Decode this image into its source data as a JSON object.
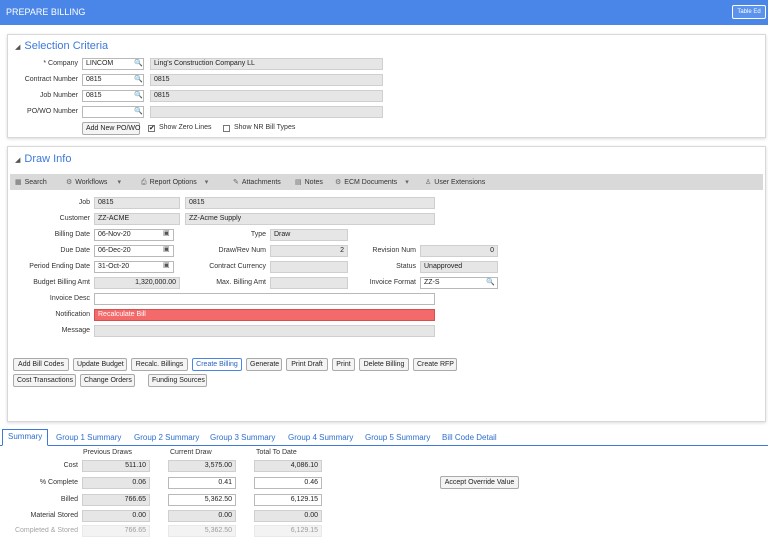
{
  "window": {
    "title": "PREPARE BILLING",
    "table_button": "Table Ed"
  },
  "selection": {
    "heading": "Selection Criteria",
    "company_label": "* Company",
    "company_value": "LINCOM",
    "company_name": "Ling's Construction Company LL",
    "contract_label": "Contract Number",
    "contract_value": "0815",
    "contract_desc": "0815",
    "job_label": "Job Number",
    "job_value": "0815",
    "job_desc": "0815",
    "powo_label": "PO/WO Number",
    "add_po_button": "Add New PO/WO",
    "show_zero_lines": "Show Zero Lines",
    "show_zero_checked": "✔",
    "show_nr_bill_types": "Show NR Bill Types"
  },
  "draw": {
    "heading": "Draw Info",
    "toolbar": {
      "search": "Search",
      "workflows": "Workflows",
      "report_options": "Report Options",
      "attachments": "Attachments",
      "notes": "Notes",
      "ecm": "ECM Documents",
      "user_ext": "User Extensions"
    },
    "job_label": "Job",
    "job_value": "0815",
    "job_desc": "0815",
    "customer_label": "Customer",
    "customer_value": "ZZ-ACME",
    "customer_name": "ZZ-Acme Supply",
    "billing_date_label": "Billing Date",
    "billing_date": "06-Nov-20",
    "type_label": "Type",
    "type_value": "Draw",
    "due_date_label": "Due Date",
    "due_date": "06-Dec-20",
    "drawrev_label": "Draw/Rev Num",
    "drawrev_value": "2",
    "revision_label": "Revision Num",
    "revision_value": "0",
    "period_label": "Period Ending Date",
    "period_value": "31-Oct-20",
    "currency_label": "Contract Currency",
    "status_label": "Status",
    "status_value": "Unapproved",
    "budget_label": "Budget Billing Amt",
    "budget_value": "1,320,000.00",
    "max_label": "Max. Billing Amt",
    "invfmt_label": "Invoice Format",
    "invfmt_value": "ZZ-S",
    "invdesc_label": "Invoice Desc",
    "notif_label": "Notification",
    "notif_value": "Recalculate Bill",
    "message_label": "Message",
    "buttons": {
      "add_bill_codes": "Add Bill Codes",
      "update_budget": "Update Budget",
      "recalc": "Recalc. Billings",
      "create_billing": "Create Billing",
      "generate": "Generate",
      "print_draft": "Print Draft",
      "print": "Print",
      "delete_billing": "Delete Billing",
      "create_rfp": "Create RFP",
      "cost_transactions": "Cost Transactions",
      "change_orders": "Change Orders",
      "funding_sources": "Funding Sources"
    }
  },
  "tabs": [
    "Summary",
    "Group 1 Summary",
    "Group 2 Summary",
    "Group 3 Summary",
    "Group 4 Summary",
    "Group 5 Summary",
    "Bill Code Detail"
  ],
  "summary": {
    "col_prev": "Previous Draws",
    "col_curr": "Current Draw",
    "col_total": "Total To Date",
    "accept_button": "Accept Override Value",
    "rows": [
      {
        "label": "Cost",
        "prev": "511.10",
        "curr": "3,575.00",
        "total": "4,086.10"
      },
      {
        "label": "% Complete",
        "prev": "0.06",
        "curr": "0.41",
        "total": "0.46"
      },
      {
        "label": "Billed",
        "prev": "766.65",
        "curr": "5,362.50",
        "total": "6,129.15"
      },
      {
        "label": "Material Stored",
        "prev": "0.00",
        "curr": "0.00",
        "total": "0.00"
      },
      {
        "label": "Completed & Stored",
        "prev": "766.65",
        "curr": "5,362.50",
        "total": "6,129.15"
      }
    ]
  }
}
